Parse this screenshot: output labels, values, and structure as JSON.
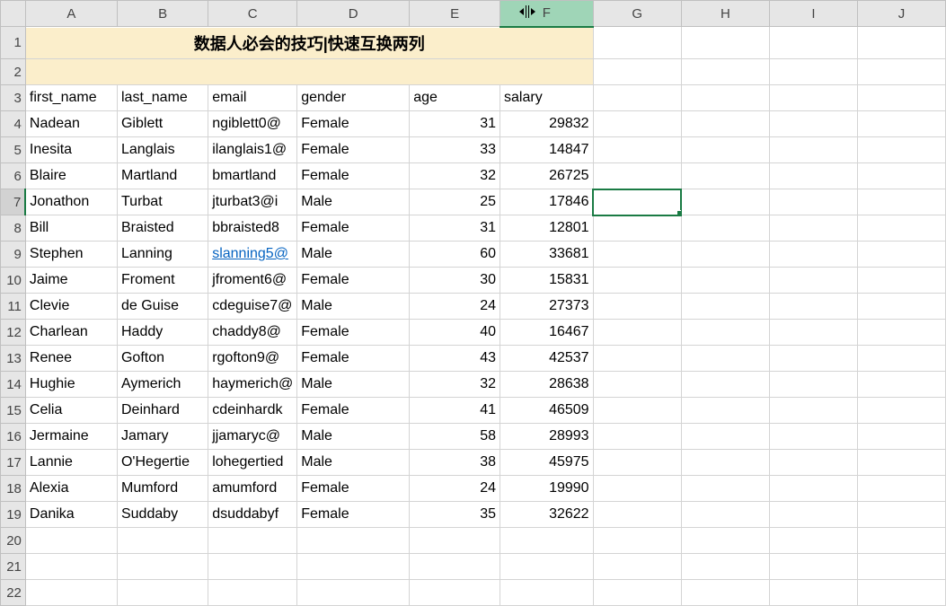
{
  "columns": [
    "A",
    "B",
    "C",
    "D",
    "E",
    "F",
    "G",
    "H",
    "I",
    "J"
  ],
  "hover_column": "F",
  "hover_row": 7,
  "selected_cell": "G7",
  "title_row": {
    "text": "数据人必会的技巧|快速互换两列",
    "colspan": 6
  },
  "headers": {
    "A": "first_name",
    "B": "last_name",
    "C": "email",
    "D": "gender",
    "E": "age",
    "F": "salary"
  },
  "rows": [
    {
      "n": 4,
      "A": "Nadean",
      "B": "Giblett",
      "C": "ngiblett0@",
      "D": "Female",
      "E": 31,
      "F": 29832
    },
    {
      "n": 5,
      "A": "Inesita",
      "B": "Langlais",
      "C": "ilanglais1@",
      "D": "Female",
      "E": 33,
      "F": 14847
    },
    {
      "n": 6,
      "A": "Blaire",
      "B": "Martland",
      "C": "bmartland",
      "D": "Female",
      "E": 32,
      "F": 26725
    },
    {
      "n": 7,
      "A": "Jonathon",
      "B": "Turbat",
      "C": "jturbat3@i",
      "D": "Male",
      "E": 25,
      "F": 17846
    },
    {
      "n": 8,
      "A": "Bill",
      "B": "Braisted",
      "C": "bbraisted8",
      "D": "Female",
      "E": 31,
      "F": 12801
    },
    {
      "n": 9,
      "A": "Stephen",
      "B": "Lanning",
      "C": "slanning5@",
      "D": "Male",
      "E": 60,
      "F": 33681,
      "link": "C"
    },
    {
      "n": 10,
      "A": "Jaime",
      "B": "Froment",
      "C": "jfroment6@",
      "D": "Female",
      "E": 30,
      "F": 15831
    },
    {
      "n": 11,
      "A": "Clevie",
      "B": "de Guise",
      "C": "cdeguise7@",
      "D": "Male",
      "E": 24,
      "F": 27373
    },
    {
      "n": 12,
      "A": "Charlean",
      "B": "Haddy",
      "C": "chaddy8@",
      "D": "Female",
      "E": 40,
      "F": 16467
    },
    {
      "n": 13,
      "A": "Renee",
      "B": "Gofton",
      "C": "rgofton9@",
      "D": "Female",
      "E": 43,
      "F": 42537
    },
    {
      "n": 14,
      "A": "Hughie",
      "B": "Aymerich",
      "C": "haymerich@",
      "D": "Male",
      "E": 32,
      "F": 28638
    },
    {
      "n": 15,
      "A": "Celia",
      "B": "Deinhard",
      "C": "cdeinhardk",
      "D": "Female",
      "E": 41,
      "F": 46509
    },
    {
      "n": 16,
      "A": "Jermaine",
      "B": "Jamary",
      "C": "jjamaryc@",
      "D": "Male",
      "E": 58,
      "F": 28993
    },
    {
      "n": 17,
      "A": "Lannie",
      "B": "O'Hegertie",
      "C": "lohegertied",
      "D": "Male",
      "E": 38,
      "F": 45975
    },
    {
      "n": 18,
      "A": "Alexia",
      "B": "Mumford",
      "C": "amumford",
      "D": "Female",
      "E": 24,
      "F": 19990
    },
    {
      "n": 19,
      "A": "Danika",
      "B": "Suddaby",
      "C": "dsuddabyf",
      "D": "Female",
      "E": 35,
      "F": 32622
    }
  ],
  "empty_rows": [
    20,
    21,
    22
  ],
  "title_row_height": 36
}
